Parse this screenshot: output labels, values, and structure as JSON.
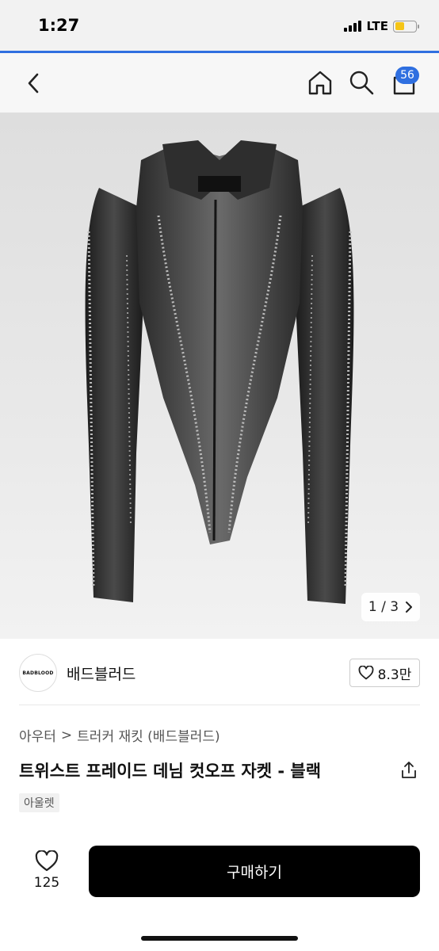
{
  "status_bar": {
    "time": "1:27",
    "network": "LTE",
    "battery_level": 0.45,
    "accent_color": "#2f6fe0"
  },
  "nav": {
    "back_icon": "chevron-left-icon",
    "home_icon": "home-icon",
    "search_icon": "search-icon",
    "cart_icon": "cart-icon",
    "cart_badge": "56"
  },
  "product_image": {
    "description_icon": "product-photo",
    "counter": "1 / 3",
    "counter_next_icon": "chevron-right-icon"
  },
  "brand": {
    "logo_text": "BADBLOOD",
    "name": "배드블러드",
    "like_count": "8.3만"
  },
  "breadcrumb": {
    "category": "아우터",
    "separator": ">",
    "subcategory": "트러커 재킷 (배드블러드)"
  },
  "product": {
    "title": "트위스트 프레이드 데님 컷오프 자켓 - 블랙",
    "tag": "아울렛"
  },
  "actions": {
    "wish_count": "125",
    "buy_label": "구매하기"
  }
}
